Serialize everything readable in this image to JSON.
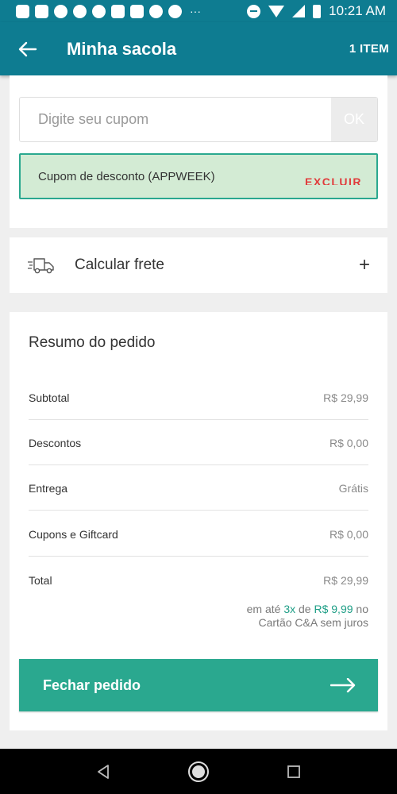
{
  "status_bar": {
    "time": "10:21 AM"
  },
  "header": {
    "title": "Minha sacola",
    "item_count": "1 ITEM"
  },
  "coupon": {
    "placeholder": "Digite seu cupom",
    "ok_label": "OK",
    "applied_text": "Cupom de desconto (APPWEEK)",
    "remove_label": "EXCLUIR"
  },
  "shipping": {
    "label": "Calcular frete",
    "expand_symbol": "+"
  },
  "summary": {
    "title": "Resumo do pedido",
    "rows": [
      {
        "label": "Subtotal",
        "value": "R$ 29,99"
      },
      {
        "label": "Descontos",
        "value": "R$ 0,00"
      },
      {
        "label": "Entrega",
        "value": "Grátis"
      },
      {
        "label": "Cupons e Giftcard",
        "value": "R$ 0,00"
      },
      {
        "label": "Total",
        "value": "R$ 29,99"
      }
    ],
    "installments": {
      "prefix": "em até",
      "count": "3x",
      "middle": "de",
      "amount": "R$ 9,99",
      "suffix": "no",
      "line2": "Cartão C&A sem juros"
    },
    "checkout_label": "Fechar pedido"
  },
  "colors": {
    "primary": "#0e7c91",
    "accent": "#2aa88f",
    "applied_bg": "#d3ebd4",
    "danger": "#e03c3c"
  },
  "icons": {
    "back": "arrow-left-icon",
    "truck": "truck-icon",
    "checkout_arrow": "arrow-right-icon"
  }
}
